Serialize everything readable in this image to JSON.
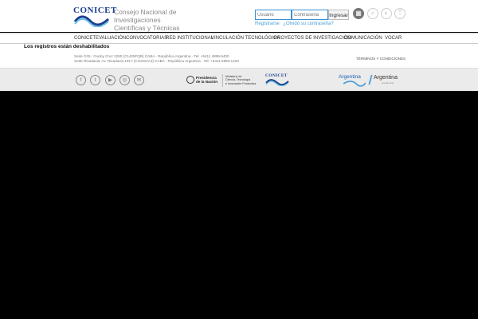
{
  "header": {
    "logo_text": "CONICET",
    "org_name_line1": "Consejo Nacional de Investigaciones",
    "org_name_line2": "Científicas y Técnicas",
    "login": {
      "user_placeholder": "Usuario",
      "pass_placeholder": "Contraseña",
      "submit_label": "Ingresar",
      "register_link": "Registrarse",
      "forgot_link": "¿Olvidó su contraseña?"
    },
    "icons": [
      "grid-icon",
      "search-icon",
      "accessibility-icon",
      "help-icon"
    ]
  },
  "nav": {
    "items": [
      "CONICET",
      "EVALUACIÓN",
      "CONVOCATORIAS",
      "RED INSTITUCIONAL",
      "VINCULACIÓN TECNOLÓGICA",
      "PROYECTOS DE INVESTIGACIÓN",
      "COMUNICACIÓN",
      "VOCAR"
    ]
  },
  "notice": "Los registros están deshabilitados",
  "addresses": [
    "Sede GOL: Godoy Cruz 2290 (C1425FQB) CABA - República Argentina - Tel: +5411 4899-5400",
    "Sede Rivadavia: Av. Rivadavia 1917 (C1033AAJ) CABA - República Argentina - Tel: +5411 5983-1420"
  ],
  "terms_link": "TÉRMINOS Y CONDICIONES",
  "footer": {
    "social_icons": [
      "facebook-icon",
      "twitter-icon",
      "youtube-icon",
      "instagram-icon",
      "email-icon"
    ],
    "presidencia_line1": "Presidencia",
    "presidencia_line2": "de la Nación",
    "ministerio_line1": "Ministerio de",
    "ministerio_line2": "Ciencia, Tecnología",
    "ministerio_line3": "e Innovación Productiva",
    "footer_logo_text": "CONICET",
    "argentina_logo1": "Argentina",
    "argentina_logo2": "Argentina",
    "argentina_logo2_sub": "presidencia"
  },
  "colors": {
    "brand_blue": "#1d3f8f",
    "accent_light_blue": "#4aa0d8",
    "footer_bg": "#ebebeb",
    "page_bg": "#000000"
  }
}
